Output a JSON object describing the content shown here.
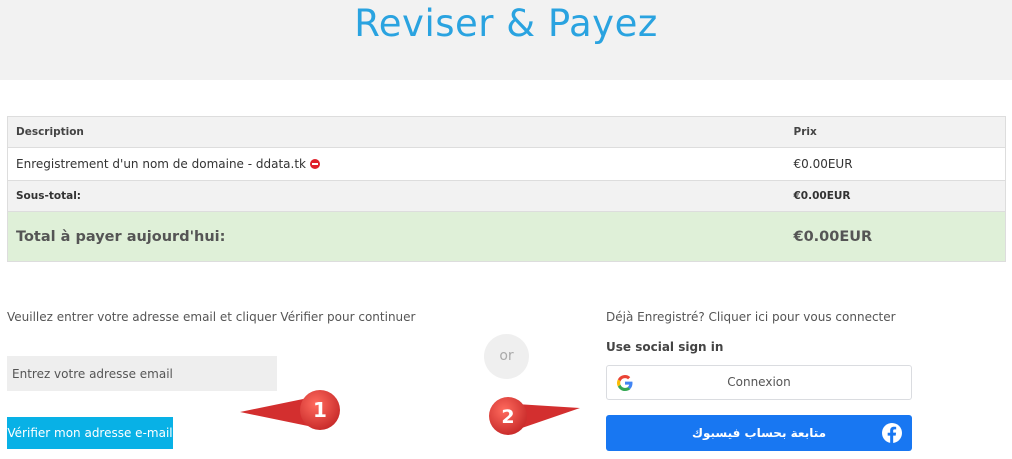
{
  "header": {
    "title": "Reviser & Payez"
  },
  "summary": {
    "col_description": "Description",
    "col_price": "Prix",
    "item_name": "Enregistrement d'un nom de domaine - ddata.tk",
    "item_price": "€0.00EUR",
    "subtotal_label": "Sous-total:",
    "subtotal_value": "€0.00EUR",
    "total_label": "Total à payer aujourd'hui:",
    "total_value": "€0.00EUR"
  },
  "email_section": {
    "instruction": "Veuillez entrer votre adresse email et cliquer Vérifier pour continuer",
    "email_placeholder": "Entrez votre adresse email",
    "verify_label": "Vérifier mon adresse e-mail"
  },
  "divider": {
    "or_label": "or"
  },
  "login_section": {
    "already_registered": "Déjà Enregistré? Cliquer ici pour vous connecter",
    "social_title": "Use social sign in",
    "google_label": "Connexion",
    "facebook_label": "متابعة بحساب فيسبوك"
  },
  "annotations": {
    "callout_1": "1",
    "callout_2": "2"
  },
  "colors": {
    "title": "#2aa3e0",
    "verify_button": "#08b1e6",
    "facebook_button": "#1877f2",
    "total_row": "#dff0d8",
    "callout": "#e53935",
    "remove_icon": "#e0202a"
  },
  "icons": [
    "remove-icon",
    "google-g-icon",
    "facebook-f-icon"
  ]
}
